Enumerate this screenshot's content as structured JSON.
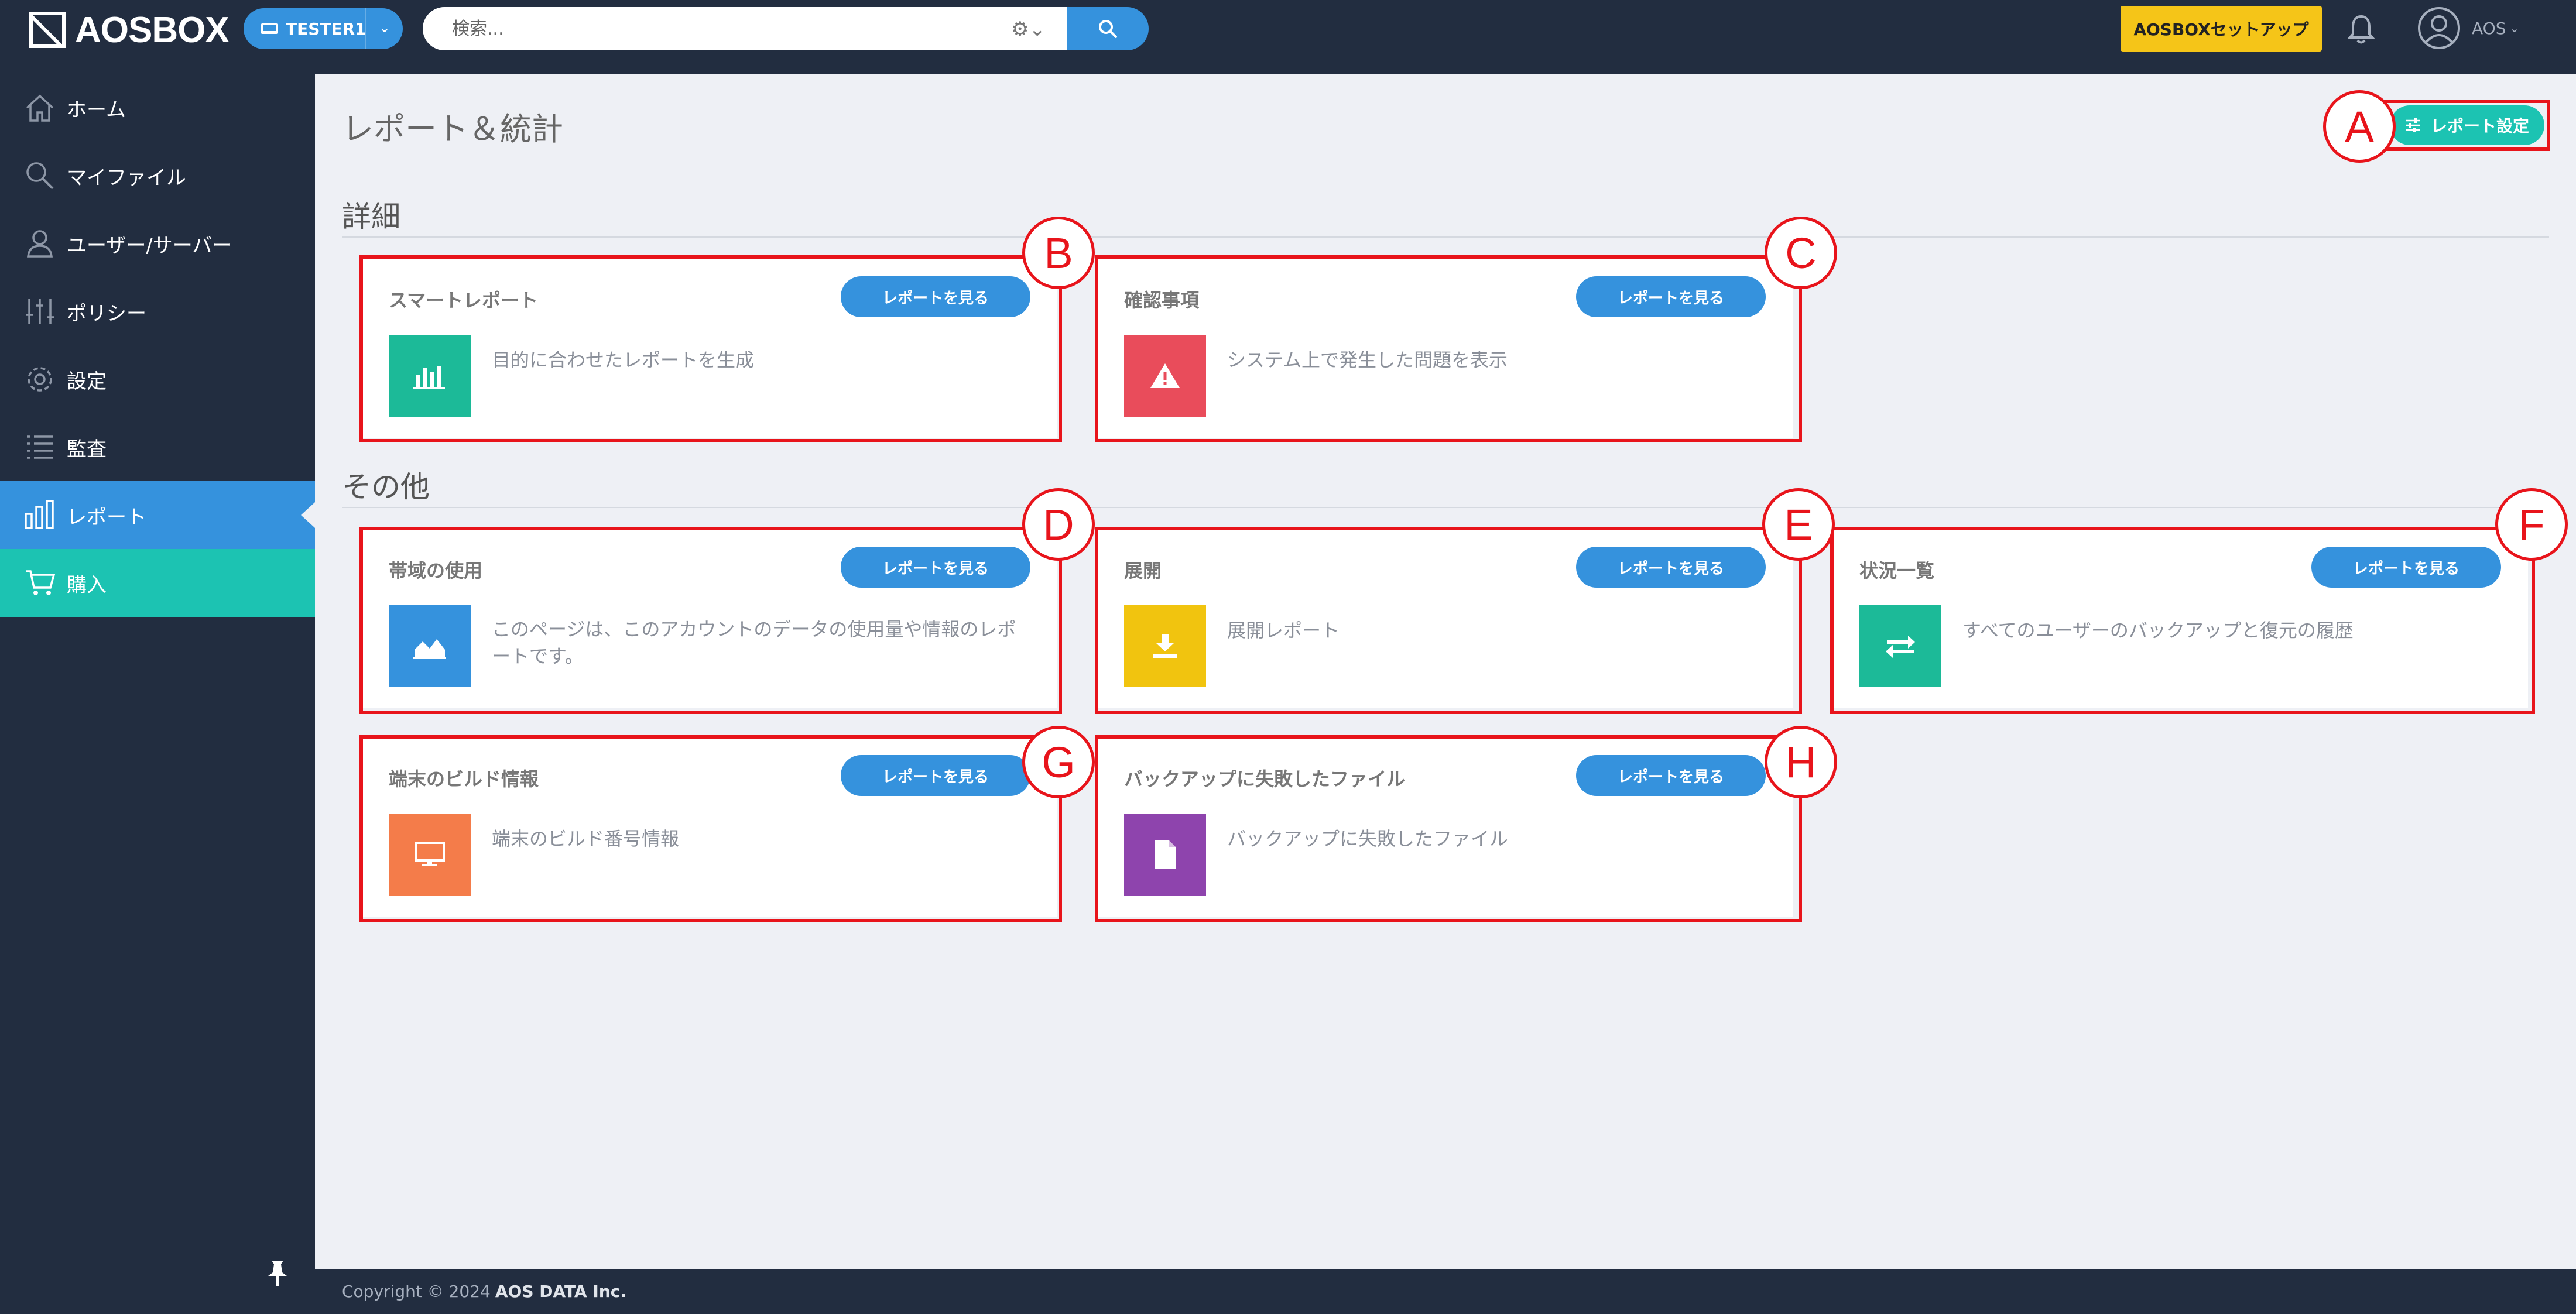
{
  "header": {
    "logo_text": "AOSBOX",
    "tenant_label": "TESTER1",
    "search_placeholder": "検索...",
    "setup_button": "AOSBOXセットアップ",
    "user_name": "AOS"
  },
  "sidebar": {
    "items": [
      {
        "label": "ホーム",
        "icon": "home-icon"
      },
      {
        "label": "マイファイル",
        "icon": "search-icon"
      },
      {
        "label": "ユーザー/サーバー",
        "icon": "users-icon"
      },
      {
        "label": "ポリシー",
        "icon": "sliders-icon"
      },
      {
        "label": "設定",
        "icon": "gear-icon"
      },
      {
        "label": "監査",
        "icon": "list-icon"
      },
      {
        "label": "レポート",
        "icon": "bar-chart-icon",
        "active": true
      },
      {
        "label": "購入",
        "icon": "cart-icon"
      }
    ]
  },
  "main": {
    "title": "レポート＆統計",
    "settings_button": "レポート設定",
    "sections": [
      {
        "title": "詳細"
      },
      {
        "title": "その他"
      }
    ],
    "cards": [
      {
        "title": "スマートレポート",
        "button": "レポートを見る",
        "desc": "目的に合わせたレポートを生成",
        "icon": "bar-chart-icon",
        "color": "#1cba98"
      },
      {
        "title": "確認事項",
        "button": "レポートを見る",
        "desc": "システム上で発生した問題を表示",
        "icon": "warning-icon",
        "color": "#e94c5b"
      },
      {
        "title": "帯域の使用",
        "button": "レポートを見る",
        "desc": "このページは、このアカウントのデータの使用量や情報のレポートです。",
        "icon": "area-chart-icon",
        "color": "#3592dd"
      },
      {
        "title": "展開",
        "button": "レポートを見る",
        "desc": "展開レポート",
        "icon": "download-icon",
        "color": "#f1c40f"
      },
      {
        "title": "状況一覧",
        "button": "レポートを見る",
        "desc": "すべてのユーザーのバックアップと復元の履歴",
        "icon": "exchange-icon",
        "color": "#1cba98"
      },
      {
        "title": "端末のビルド情報",
        "button": "レポートを見る",
        "desc": "端末のビルド番号情報",
        "icon": "monitor-icon",
        "color": "#f47c4a"
      },
      {
        "title": "バックアップに失敗したファイル",
        "button": "レポートを見る",
        "desc": "バックアップに失敗したファイル",
        "icon": "file-icon",
        "color": "#8e44ad"
      }
    ]
  },
  "markers": [
    "A",
    "B",
    "C",
    "D",
    "E",
    "F",
    "G",
    "H"
  ],
  "footer": {
    "copyright": "Copyright © 2024",
    "company": "AOS DATA Inc."
  }
}
